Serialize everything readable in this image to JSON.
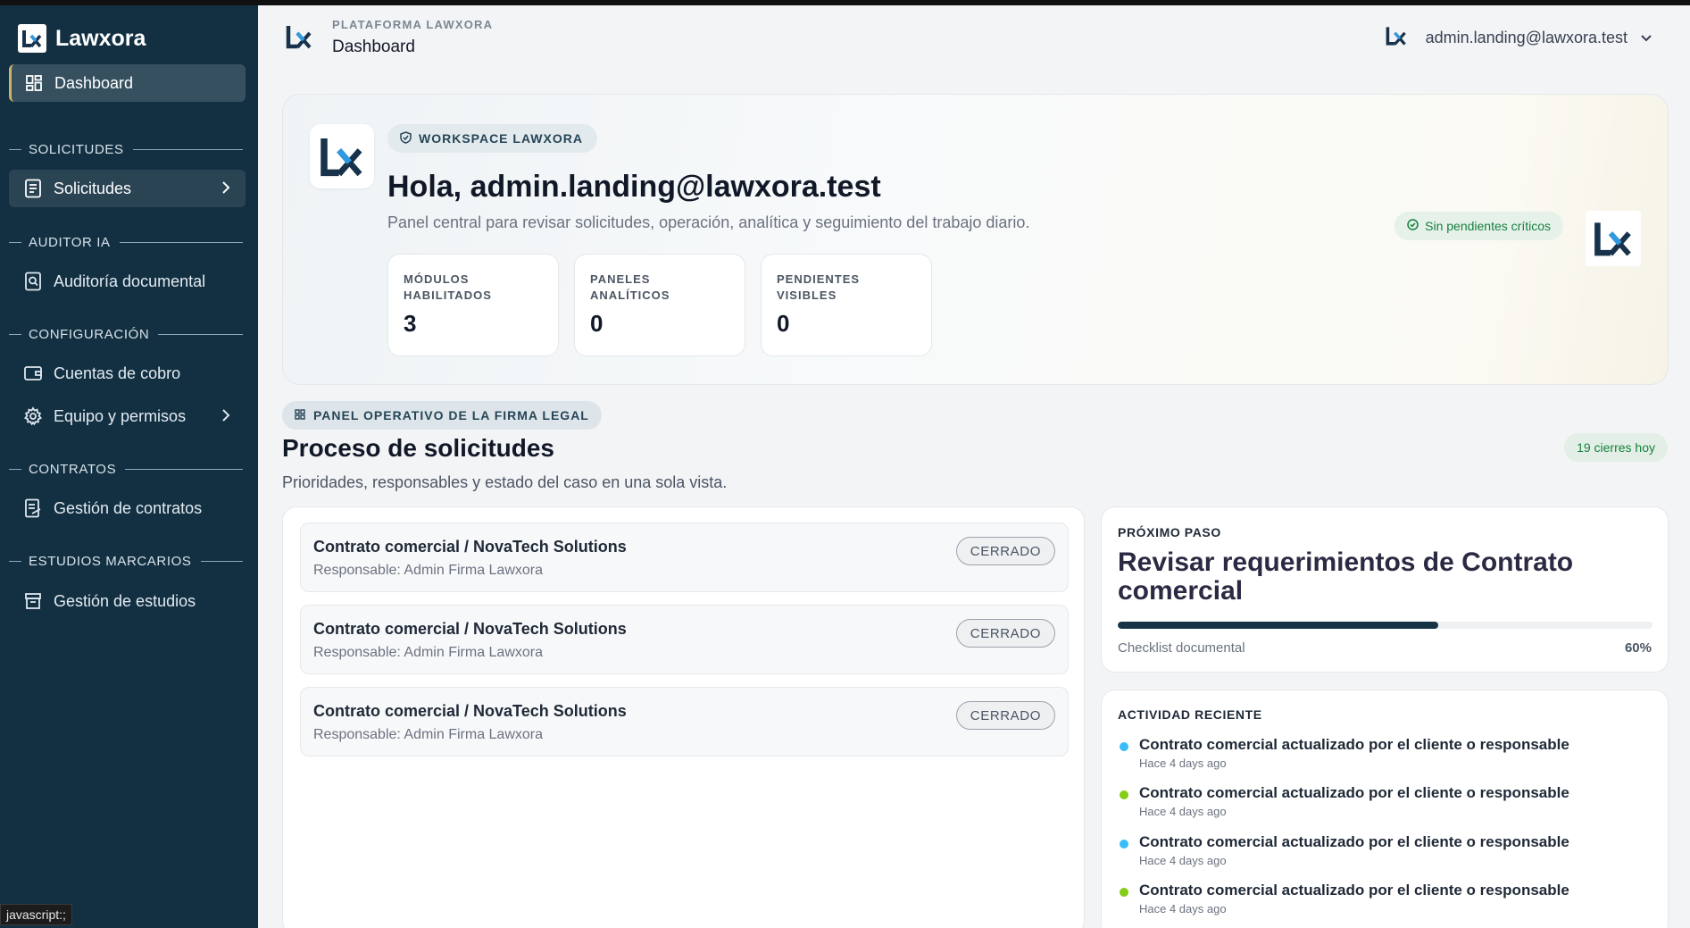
{
  "brand": {
    "name": "Lawxora"
  },
  "sidebar": {
    "dashboard": "Dashboard",
    "sections": [
      {
        "title": "SOLICITUDES",
        "items": [
          {
            "label": "Solicitudes",
            "icon": "document-list-icon",
            "has_submenu": true
          }
        ]
      },
      {
        "title": "AUDITOR IA",
        "items": [
          {
            "label": "Auditoría documental",
            "icon": "document-search-icon"
          }
        ]
      },
      {
        "title": "CONFIGURACIÓN",
        "items": [
          {
            "label": "Cuentas de cobro",
            "icon": "wallet-icon"
          },
          {
            "label": "Equipo y permisos",
            "icon": "gear-icon",
            "has_submenu": true
          }
        ]
      },
      {
        "title": "CONTRATOS",
        "items": [
          {
            "label": "Gestión de contratos",
            "icon": "contract-icon"
          }
        ]
      },
      {
        "title": "ESTUDIOS MARCARIOS",
        "items": [
          {
            "label": "Gestión de estudios",
            "icon": "archive-icon"
          }
        ]
      }
    ]
  },
  "status_tooltip": "javascript:;",
  "header": {
    "kicker": "PLATAFORMA LAWXORA",
    "title": "Dashboard",
    "user_email": "admin.landing@lawxora.test"
  },
  "hero": {
    "pill": "WORKSPACE LAWXORA",
    "greeting": "Hola, admin.landing@lawxora.test",
    "subtitle": "Panel central para revisar solicitudes, operación, analítica y seguimiento del trabajo diario.",
    "badge": "Sin pendientes críticos",
    "stats": [
      {
        "label1": "MÓDULOS",
        "label2": "HABILITADOS",
        "value": "3"
      },
      {
        "label1": "PANELES",
        "label2": "ANALÍTICOS",
        "value": "0"
      },
      {
        "label1": "PENDIENTES",
        "label2": "VISIBLES",
        "value": "0"
      }
    ]
  },
  "panel": {
    "pill": "PANEL OPERATIVO DE LA FIRMA LEGAL",
    "title": "Proceso de solicitudes",
    "subtitle": "Prioridades, responsables y estado del caso en una sola vista.",
    "badge": "19 cierres hoy",
    "rows": [
      {
        "title": "Contrato comercial / NovaTech Solutions",
        "owner": "Responsable: Admin Firma Lawxora",
        "status": "CERRADO"
      },
      {
        "title": "Contrato comercial / NovaTech Solutions",
        "owner": "Responsable: Admin Firma Lawxora",
        "status": "CERRADO"
      },
      {
        "title": "Contrato comercial / NovaTech Solutions",
        "owner": "Responsable: Admin Firma Lawxora",
        "status": "CERRADO"
      }
    ]
  },
  "next_step": {
    "kicker": "PRÓXIMO PASO",
    "title": "Revisar requerimientos de Contrato comercial",
    "progress_label": "Checklist documental",
    "progress_value": "60%",
    "progress_fraction": 0.6
  },
  "activity": {
    "kicker": "ACTIVIDAD RECIENTE",
    "items": [
      {
        "text": "Contrato comercial actualizado por el cliente o responsable",
        "when": "Hace 4 days ago",
        "color": "#38bdf8"
      },
      {
        "text": "Contrato comercial actualizado por el cliente o responsable",
        "when": "Hace 4 days ago",
        "color": "#84cc16"
      },
      {
        "text": "Contrato comercial actualizado por el cliente o responsable",
        "when": "Hace 4 days ago",
        "color": "#38bdf8"
      },
      {
        "text": "Contrato comercial actualizado por el cliente o responsable",
        "when": "Hace 4 days ago",
        "color": "#84cc16"
      }
    ]
  },
  "colors": {
    "sidebar_bg": "#133042",
    "accent_gold": "#c9b26a",
    "success": "#15803d",
    "logo_blue": "#2f9ae0",
    "logo_dark": "#17324a"
  }
}
